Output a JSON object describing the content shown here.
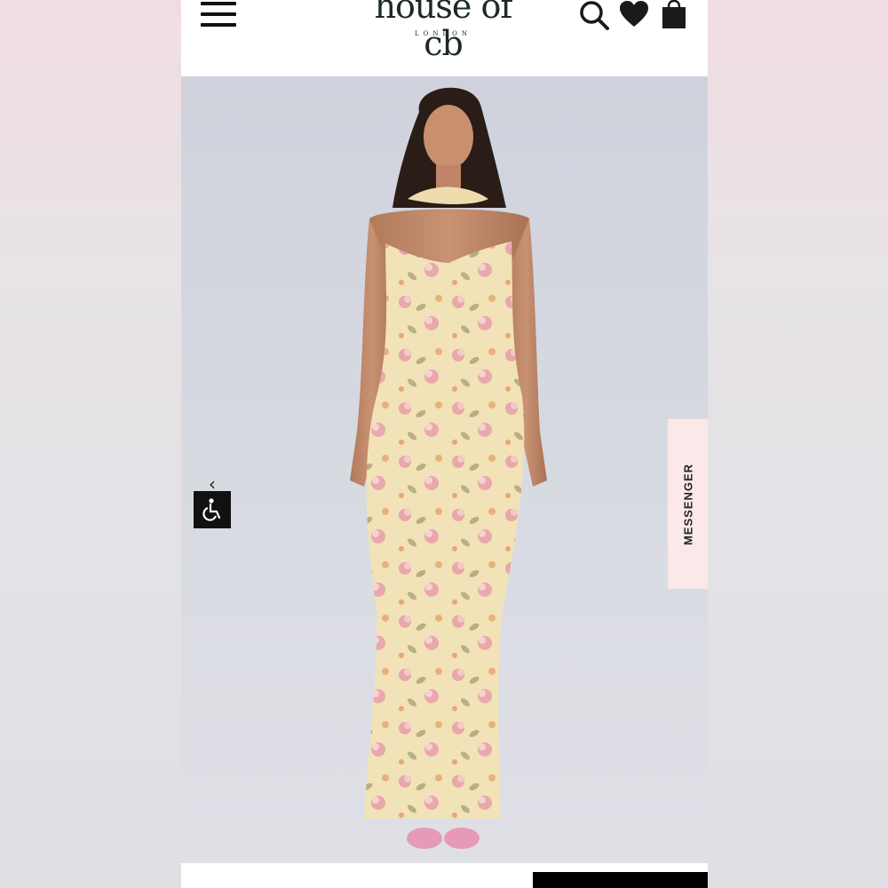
{
  "header": {
    "logo_text": "house of cb",
    "logo_sub": "LONDON",
    "menu_icon": "hamburger-menu-icon",
    "search_icon": "search-icon",
    "wishlist_icon": "heart-icon",
    "bag_icon": "shopping-bag-icon"
  },
  "gallery": {
    "prev_glyph": "‹",
    "accessibility_icon": "wheelchair-icon"
  },
  "messenger": {
    "label": "MESSENGER"
  },
  "colors": {
    "brand": "#1c2a24",
    "messenger_bg": "#fbe8e8",
    "photo_bg": "#d8dae2"
  }
}
